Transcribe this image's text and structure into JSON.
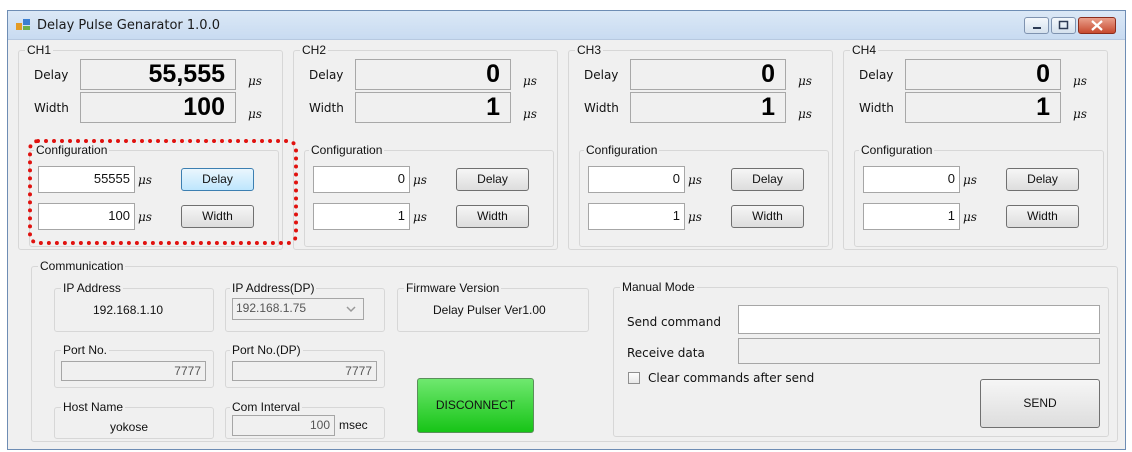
{
  "window": {
    "title": "Delay Pulse Genarator 1.0.0"
  },
  "units": {
    "us": "μs",
    "msec": "msec"
  },
  "labels": {
    "delay": "Delay",
    "width": "Width",
    "configuration": "Configuration"
  },
  "channels": [
    {
      "name": "CH1",
      "delay_value": "55,555",
      "width_value": "100",
      "delay_input": "55555",
      "width_input": "100",
      "delay_button": "Delay",
      "width_button": "Width"
    },
    {
      "name": "CH2",
      "delay_value": "0",
      "width_value": "1",
      "delay_input": "0",
      "width_input": "1",
      "delay_button": "Delay",
      "width_button": "Width"
    },
    {
      "name": "CH3",
      "delay_value": "0",
      "width_value": "1",
      "delay_input": "0",
      "width_input": "1",
      "delay_button": "Delay",
      "width_button": "Width"
    },
    {
      "name": "CH4",
      "delay_value": "0",
      "width_value": "1",
      "delay_input": "0",
      "width_input": "1",
      "delay_button": "Delay",
      "width_button": "Width"
    }
  ],
  "communication": {
    "title": "Communication",
    "ip_address_label": "IP Address",
    "ip_address": "192.168.1.10",
    "ip_dp_label": "IP Address(DP)",
    "ip_dp": "192.168.1.75",
    "firmware_label": "Firmware Version",
    "firmware": "Delay Pulser Ver1.00",
    "port_label": "Port No.",
    "port": "7777",
    "port_dp_label": "Port No.(DP)",
    "port_dp": "7777",
    "host_label": "Host Name",
    "host": "yokose",
    "com_interval_label": "Com Interval",
    "com_interval": "100",
    "disconnect_button": "DISCONNECT"
  },
  "manual": {
    "title": "Manual Mode",
    "send_command_label": "Send command",
    "send_command_value": "",
    "receive_label": "Receive data",
    "receive_value": "",
    "clear_checkbox_label": "Clear commands after send",
    "send_button": "SEND"
  },
  "colors": {
    "highlight": "#e0120f",
    "disconnect": "#22cc22"
  }
}
